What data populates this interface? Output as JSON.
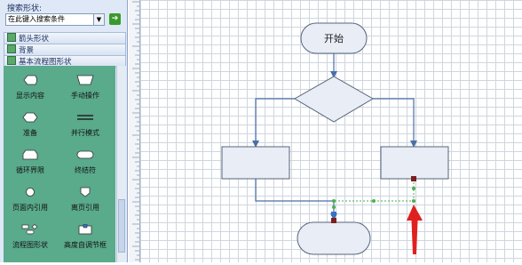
{
  "panel": {
    "search_label": "搜索形状:",
    "search_placeholder": "在此键入搜索条件",
    "stencils": [
      "箭头形状",
      "背景",
      "基本流程图形状"
    ]
  },
  "shapes": [
    {
      "label": "显示内容",
      "icon": "display-shape-icon"
    },
    {
      "label": "手动操作",
      "icon": "manual-operation-icon"
    },
    {
      "label": "准备",
      "icon": "preparation-icon"
    },
    {
      "label": "并行模式",
      "icon": "parallel-mode-icon"
    },
    {
      "label": "循环界限",
      "icon": "loop-limit-icon"
    },
    {
      "label": "终结符",
      "icon": "terminator-icon"
    },
    {
      "label": "页面内引用",
      "icon": "on-page-reference-icon"
    },
    {
      "label": "离页引用",
      "icon": "off-page-reference-icon"
    },
    {
      "label": "流程图形状",
      "icon": "flowchart-shapes-icon"
    },
    {
      "label": "高度自调节框",
      "icon": "auto-height-box-icon"
    }
  ],
  "diagram": {
    "start_label": "开始"
  },
  "colors": {
    "shape_fill": "#e8edf6",
    "shape_stroke": "#56657a",
    "connector": "#4a6fa8",
    "selected_marker": "#7a1f1f",
    "glue_point": "#4caf50",
    "red_arrow": "#e02020",
    "shapes_panel_bg": "#5aaa8c"
  }
}
